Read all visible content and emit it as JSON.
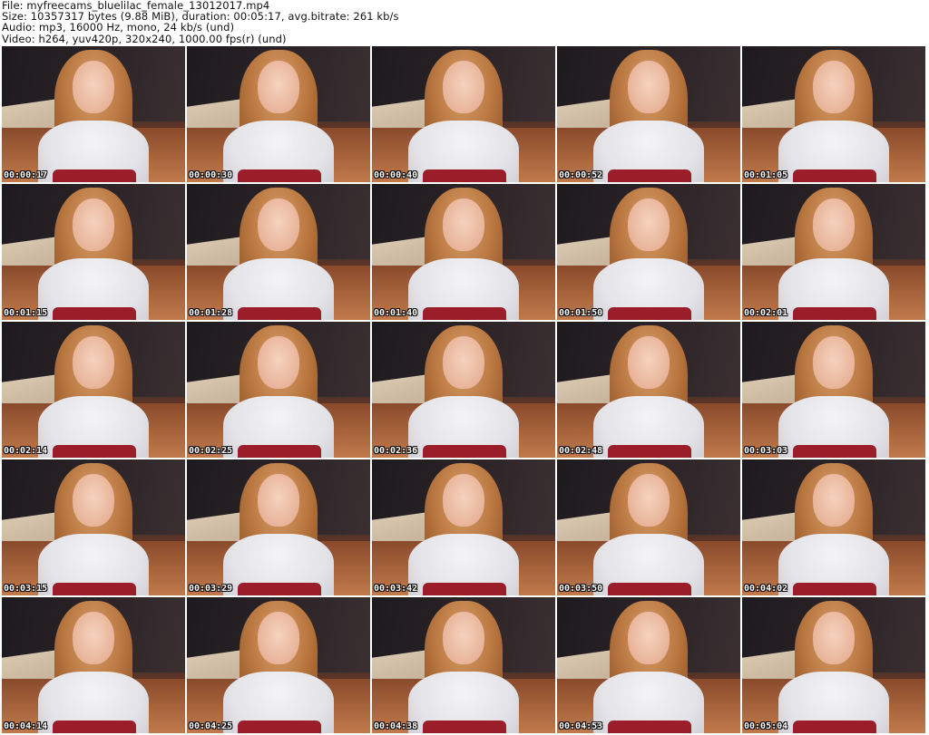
{
  "header": {
    "file_line": "File: myfreecams_bluelilac_female_13012017.mp4",
    "size_line": "Size: 10357317 bytes (9.88 MiB), duration: 00:05:17, avg.bitrate: 261 kb/s",
    "audio_line": "Audio: mp3, 16000 Hz, mono, 24 kb/s (und)",
    "video_line": "Video: h264, yuv420p, 320x240, 1000.00 fps(r) (und)"
  },
  "thumbnails": [
    {
      "time": "00:00:17"
    },
    {
      "time": "00:00:30"
    },
    {
      "time": "00:00:40"
    },
    {
      "time": "00:00:52"
    },
    {
      "time": "00:01:05"
    },
    {
      "time": "00:01:15"
    },
    {
      "time": "00:01:28"
    },
    {
      "time": "00:01:40"
    },
    {
      "time": "00:01:50"
    },
    {
      "time": "00:02:01"
    },
    {
      "time": "00:02:14"
    },
    {
      "time": "00:02:25"
    },
    {
      "time": "00:02:36"
    },
    {
      "time": "00:02:48"
    },
    {
      "time": "00:03:03"
    },
    {
      "time": "00:03:15"
    },
    {
      "time": "00:03:29"
    },
    {
      "time": "00:03:42"
    },
    {
      "time": "00:03:50"
    },
    {
      "time": "00:04:02"
    },
    {
      "time": "00:04:14"
    },
    {
      "time": "00:04:25"
    },
    {
      "time": "00:04:38"
    },
    {
      "time": "00:04:53"
    },
    {
      "time": "00:05:04"
    }
  ]
}
